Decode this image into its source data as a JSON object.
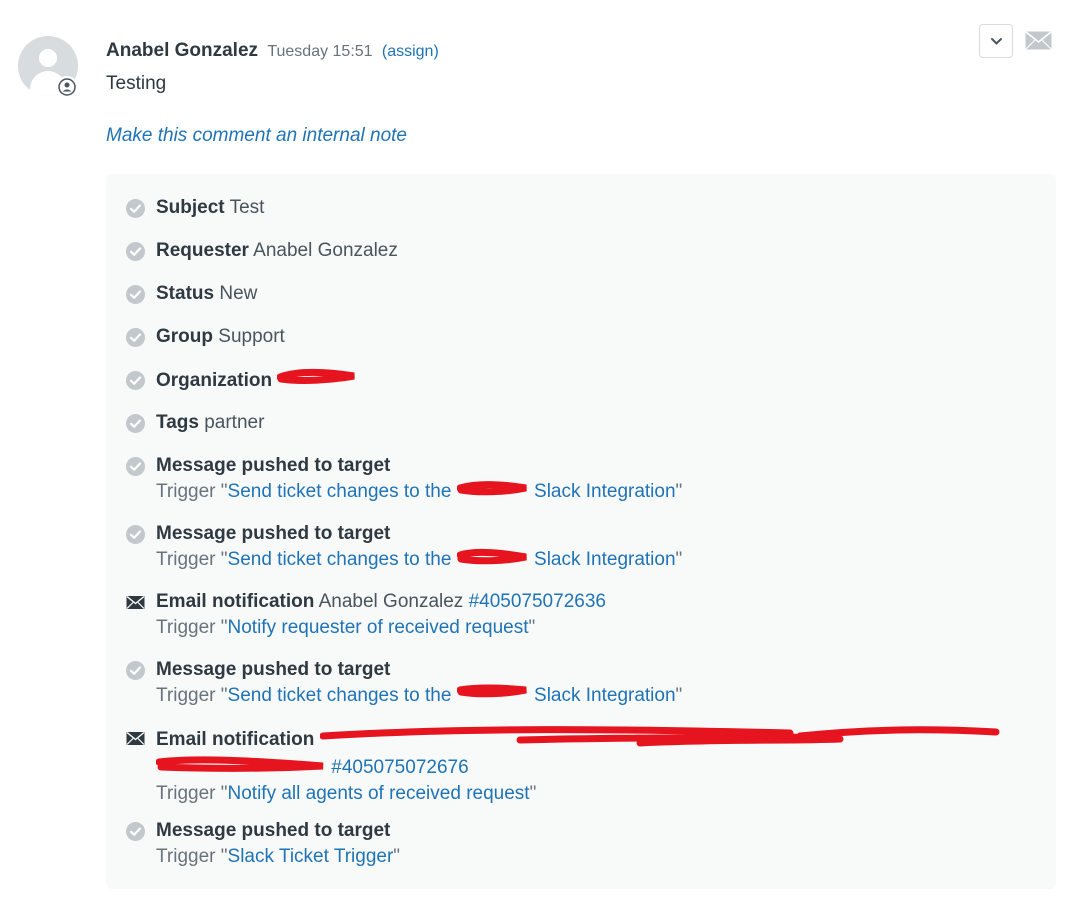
{
  "comment": {
    "author": "Anabel Gonzalez",
    "time": "Tuesday 15:51",
    "assign_label": "(assign)",
    "body": "Testing",
    "internal_note_link": "Make this comment an internal note"
  },
  "icons": {
    "avatar": "avatar-icon",
    "badge": "end-user-icon",
    "menu": "chevron-down-icon",
    "mail": "envelope-icon",
    "check": "check-circle-icon",
    "email": "envelope-closed-icon"
  },
  "colors": {
    "link": "#1f73b7",
    "panel": "#f8f9f9",
    "redaction": "#e5141e",
    "check": "#c2c8cc"
  },
  "events": {
    "subject": {
      "label": "Subject",
      "value": "Test"
    },
    "requester": {
      "label": "Requester",
      "value": "Anabel Gonzalez"
    },
    "status": {
      "label": "Status",
      "value": "New"
    },
    "group": {
      "label": "Group",
      "value": "Support"
    },
    "organization": {
      "label": "Organization",
      "value": "[redacted]"
    },
    "tags": {
      "label": "Tags",
      "value": "partner"
    },
    "push1": {
      "label": "Message pushed to target",
      "trigger_prefix": "Trigger",
      "link_start": "Send ticket changes to the",
      "link_end": "Slack Integration"
    },
    "push2": {
      "label": "Message pushed to target",
      "trigger_prefix": "Trigger",
      "link_start": "Send ticket changes to the",
      "link_end": "Slack Integration"
    },
    "email1": {
      "label": "Email notification",
      "recipients": "Anabel Gonzalez",
      "ticket_link": "#405075072636",
      "trigger_prefix": "Trigger",
      "trigger_link": "Notify requester of received request"
    },
    "push3": {
      "label": "Message pushed to target",
      "trigger_prefix": "Trigger",
      "link_start": "Send ticket changes to the",
      "link_end": "Slack Integration"
    },
    "email2": {
      "label": "Email notification",
      "ticket_link": "#405075072676",
      "trigger_prefix": "Trigger",
      "trigger_link": "Notify all agents of received request"
    },
    "push4": {
      "label": "Message pushed to target",
      "trigger_prefix": "Trigger",
      "trigger_link": "Slack Ticket Trigger"
    }
  }
}
